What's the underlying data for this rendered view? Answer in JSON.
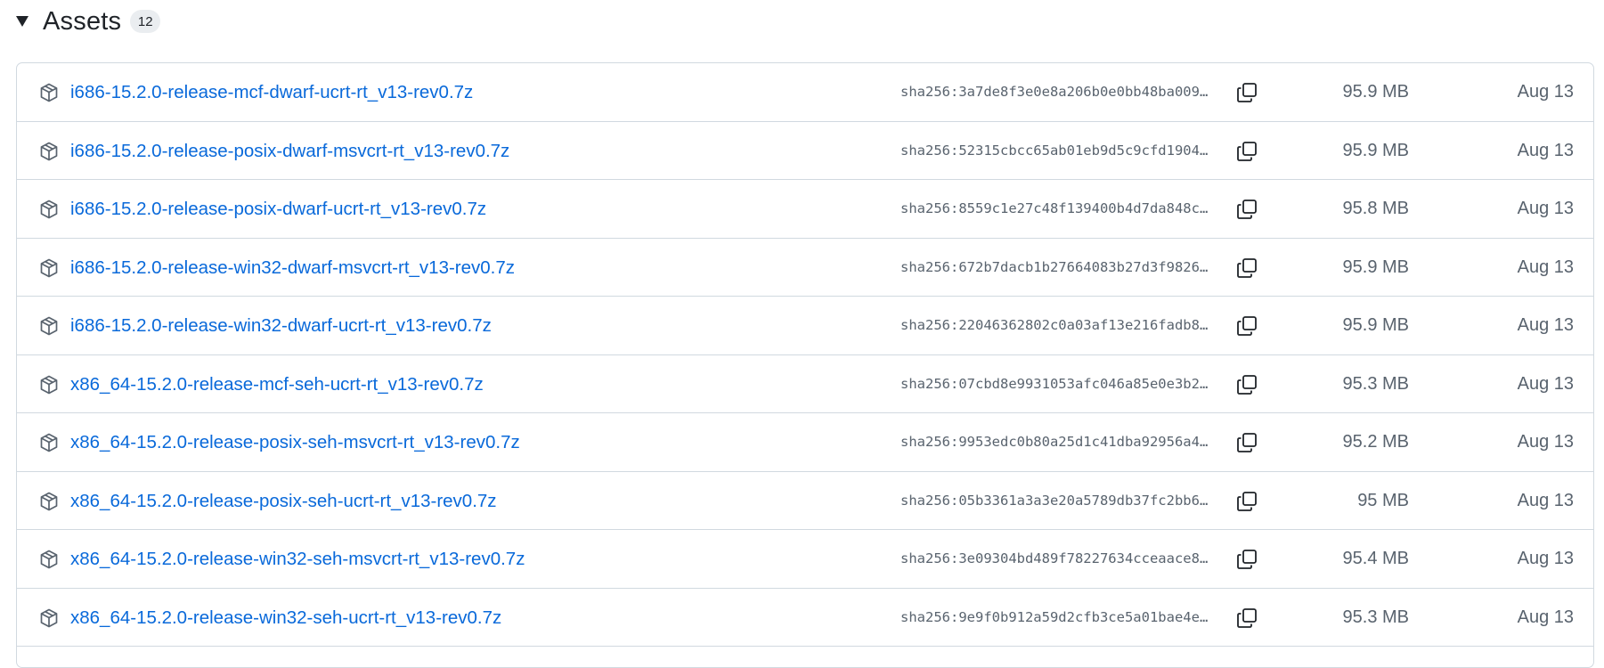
{
  "header": {
    "title": "Assets",
    "count": "12"
  },
  "colors": {
    "link": "#0969da",
    "muted": "#59636e",
    "border": "#d1d9e0",
    "counter_bg": "#eaedf0"
  },
  "icons": {
    "toggle": "triangle-down-icon",
    "asset": "package-icon",
    "copy": "copy-icon"
  },
  "assets": [
    {
      "name": "i686-15.2.0-release-mcf-dwarf-ucrt-rt_v13-rev0.7z",
      "sha": "sha256:3a7de8f3e0e8a206b0e0bb48ba009…",
      "size": "95.9 MB",
      "date": "Aug 13"
    },
    {
      "name": "i686-15.2.0-release-posix-dwarf-msvcrt-rt_v13-rev0.7z",
      "sha": "sha256:52315cbcc65ab01eb9d5c9cfd1904…",
      "size": "95.9 MB",
      "date": "Aug 13"
    },
    {
      "name": "i686-15.2.0-release-posix-dwarf-ucrt-rt_v13-rev0.7z",
      "sha": "sha256:8559c1e27c48f139400b4d7da848c…",
      "size": "95.8 MB",
      "date": "Aug 13"
    },
    {
      "name": "i686-15.2.0-release-win32-dwarf-msvcrt-rt_v13-rev0.7z",
      "sha": "sha256:672b7dacb1b27664083b27d3f9826…",
      "size": "95.9 MB",
      "date": "Aug 13"
    },
    {
      "name": "i686-15.2.0-release-win32-dwarf-ucrt-rt_v13-rev0.7z",
      "sha": "sha256:22046362802c0a03af13e216fadb8…",
      "size": "95.9 MB",
      "date": "Aug 13"
    },
    {
      "name": "x86_64-15.2.0-release-mcf-seh-ucrt-rt_v13-rev0.7z",
      "sha": "sha256:07cbd8e9931053afc046a85e0e3b2…",
      "size": "95.3 MB",
      "date": "Aug 13"
    },
    {
      "name": "x86_64-15.2.0-release-posix-seh-msvcrt-rt_v13-rev0.7z",
      "sha": "sha256:9953edc0b80a25d1c41dba92956a4…",
      "size": "95.2 MB",
      "date": "Aug 13"
    },
    {
      "name": "x86_64-15.2.0-release-posix-seh-ucrt-rt_v13-rev0.7z",
      "sha": "sha256:05b3361a3a3e20a5789db37fc2bb6…",
      "size": "95 MB",
      "date": "Aug 13"
    },
    {
      "name": "x86_64-15.2.0-release-win32-seh-msvcrt-rt_v13-rev0.7z",
      "sha": "sha256:3e09304bd489f78227634cceaace8…",
      "size": "95.4 MB",
      "date": "Aug 13"
    },
    {
      "name": "x86_64-15.2.0-release-win32-seh-ucrt-rt_v13-rev0.7z",
      "sha": "sha256:9e9f0b912a59d2cfb3ce5a01bae4e…",
      "size": "95.3 MB",
      "date": "Aug 13"
    }
  ]
}
